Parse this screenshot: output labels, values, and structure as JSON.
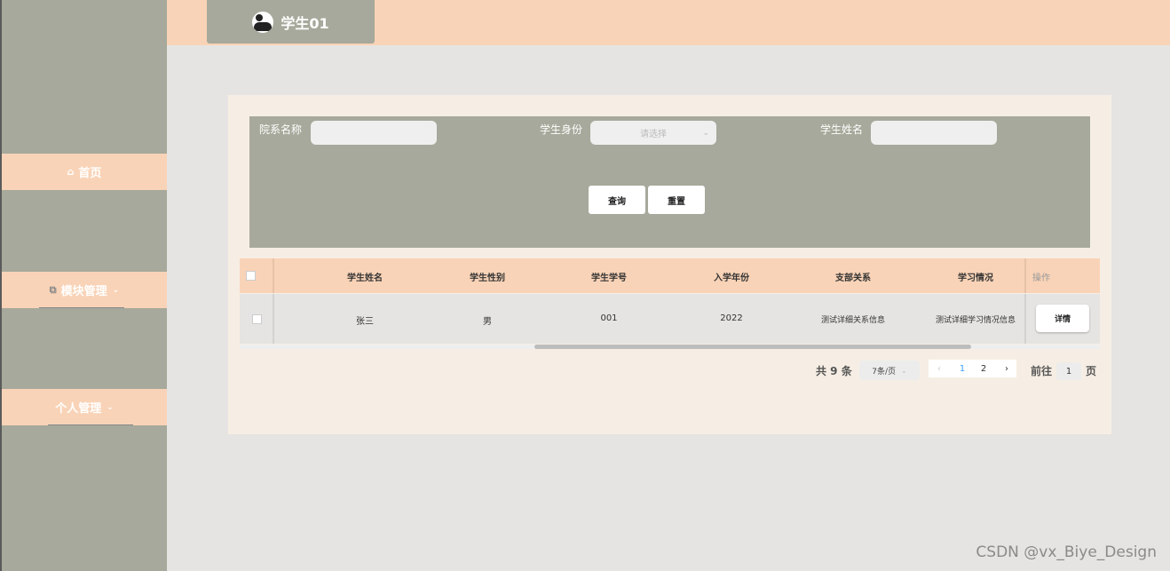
{
  "user": {
    "name": "学生01"
  },
  "sidebar": {
    "items": [
      {
        "icon": "home-icon",
        "glyph": "⌂",
        "label": "首页"
      },
      {
        "icon": "copy-icon",
        "glyph": "⧉",
        "label": "模块管理",
        "chevron": "⌄"
      },
      {
        "label": "个人管理",
        "chevron": "⌄"
      }
    ]
  },
  "search": {
    "dept_label": "院系名称",
    "dept_value": "",
    "identity_label": "学生身份",
    "identity_placeholder": "请选择",
    "identity_chevron": "⌄",
    "name_label": "学生姓名",
    "name_value": "",
    "query_button": "查询",
    "reset_button": "重置"
  },
  "table": {
    "columns": [
      "学生姓名",
      "学生性别",
      "学生学号",
      "入学年份",
      "支部关系",
      "学习情况",
      "操作"
    ],
    "rows": [
      {
        "cells": [
          "张三",
          "男",
          "001",
          "2022",
          "测试详细关系信息",
          "测试详细学习情况信息"
        ],
        "action": "详情"
      }
    ]
  },
  "pagination": {
    "total_text": "共 9 条",
    "page_size": "7条/页",
    "size_chevron": "⌄",
    "prev": "‹",
    "pages": [
      "1",
      "2"
    ],
    "current_page": "1",
    "next": "›",
    "goto_label": "前往",
    "goto_value": "1",
    "page_suffix": "页"
  },
  "watermark": "CSDN @vx_Biye_Design",
  "colors": {
    "accent_peach": "#f9d3b7",
    "sage": "#a6a99b",
    "panel_bg": "#f6eee4",
    "page_bg": "#e6e4e2",
    "active_page": "#409eff"
  }
}
